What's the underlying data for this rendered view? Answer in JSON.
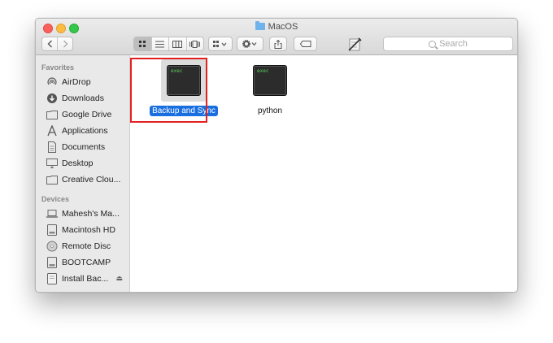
{
  "window": {
    "title": "MacOS",
    "search_placeholder": "Search"
  },
  "sidebar": {
    "favorites_header": "Favorites",
    "favorites": [
      {
        "label": "AirDrop",
        "icon": "airdrop-icon"
      },
      {
        "label": "Downloads",
        "icon": "downloads-icon"
      },
      {
        "label": "Google Drive",
        "icon": "folder-icon"
      },
      {
        "label": "Applications",
        "icon": "applications-icon"
      },
      {
        "label": "Documents",
        "icon": "documents-icon"
      },
      {
        "label": "Desktop",
        "icon": "desktop-icon"
      },
      {
        "label": "Creative Clou...",
        "icon": "folder-icon"
      }
    ],
    "devices_header": "Devices",
    "devices": [
      {
        "label": "Mahesh's Ma...",
        "icon": "laptop-icon"
      },
      {
        "label": "Macintosh HD",
        "icon": "hard-drive-icon"
      },
      {
        "label": "Remote Disc",
        "icon": "disc-icon"
      },
      {
        "label": "BOOTCAMP",
        "icon": "hard-drive-icon"
      },
      {
        "label": "Install Bac...",
        "icon": "external-drive-icon"
      }
    ]
  },
  "files": [
    {
      "name": "Backup and Sync",
      "thumb_text": "exec",
      "selected": true
    },
    {
      "name": "python",
      "thumb_text": "exec",
      "selected": false
    }
  ],
  "colors": {
    "selection": "#1a6fe0",
    "highlight_border": "#e32020",
    "terminal_text": "#58d35a"
  }
}
